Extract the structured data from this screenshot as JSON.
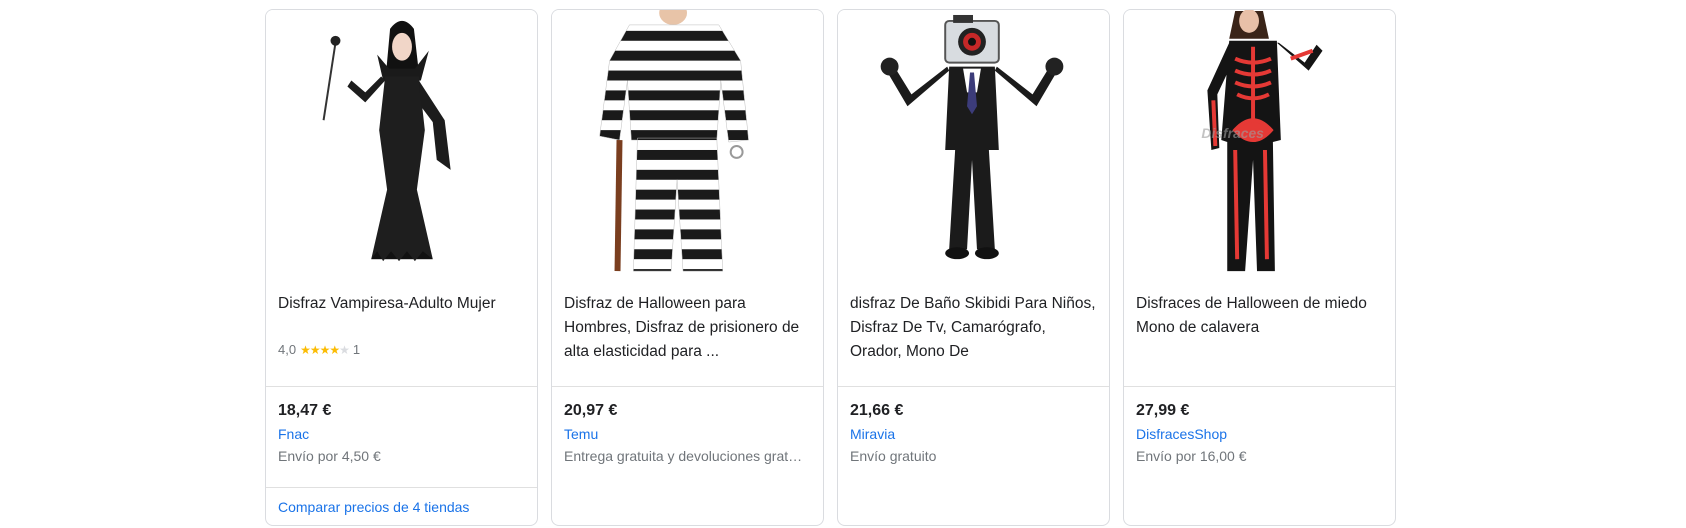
{
  "products": [
    {
      "title": "Disfraz Vampiresa-Adulto Mujer",
      "rating_value": "4,0",
      "rating_stars": 4,
      "rating_count": "1",
      "price": "18,47 €",
      "merchant": "Fnac",
      "shipping": "Envío por 4,50 €",
      "compare": "Comparar precios de 4 tiendas"
    },
    {
      "title": "Disfraz de Halloween para Hombres, Disfraz de prisionero de alta elasticidad para ...",
      "price": "20,97 €",
      "merchant": "Temu",
      "shipping": "Entrega gratuita y devoluciones grat…"
    },
    {
      "title": "disfraz De Baño Skibidi Para Niños, Disfraz De Tv, Camarógrafo, Orador, Mono De",
      "price": "21,66 €",
      "merchant": "Miravia",
      "shipping": "Envío gratuito"
    },
    {
      "title": "Disfraces de Halloween de miedo Mono de calavera",
      "price": "27,99 €",
      "merchant": "DisfracesShop",
      "shipping": "Envío por 16,00 €",
      "image_watermark": "Disfraces"
    }
  ]
}
